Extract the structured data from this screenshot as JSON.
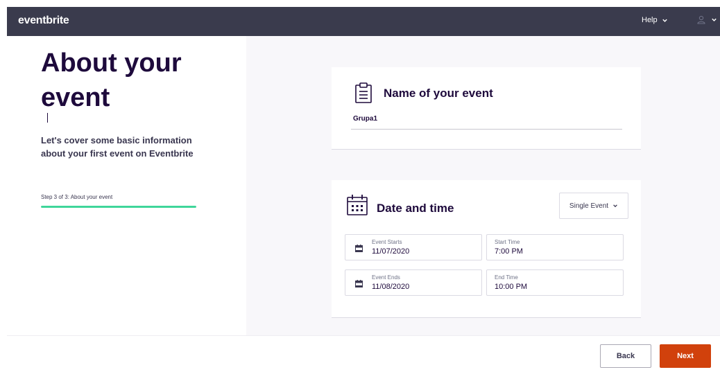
{
  "header": {
    "logo": "eventbrite",
    "help_label": "Help"
  },
  "intro": {
    "title": "About your event",
    "description": "Let's cover some basic information about your first event on Eventbrite",
    "step_text": "Step 3 of 3: About your event",
    "progress_percent": 100
  },
  "name_section": {
    "title": "Name of your event",
    "input_value": "Grupa1"
  },
  "date_section": {
    "title": "Date and time",
    "event_type": "Single Event",
    "event_starts_label": "Event Starts",
    "event_starts_value": "11/07/2020",
    "start_time_label": "Start Time",
    "start_time_value": "7:00 PM",
    "event_ends_label": "Event Ends",
    "event_ends_value": "11/08/2020",
    "end_time_label": "End Time",
    "end_time_value": "10:00 PM"
  },
  "footer": {
    "back_label": "Back",
    "next_label": "Next"
  },
  "colors": {
    "topbar": "#3a3b4d",
    "heading": "#1e0a3c",
    "progress": "#3fd69a",
    "next_button": "#d1410c"
  },
  "icons": {
    "name_section": "clipboard-icon",
    "date_section": "calendar-icon",
    "date_field": "calendar-small-icon",
    "user": "user-icon",
    "dropdown": "chevron-down-icon"
  }
}
